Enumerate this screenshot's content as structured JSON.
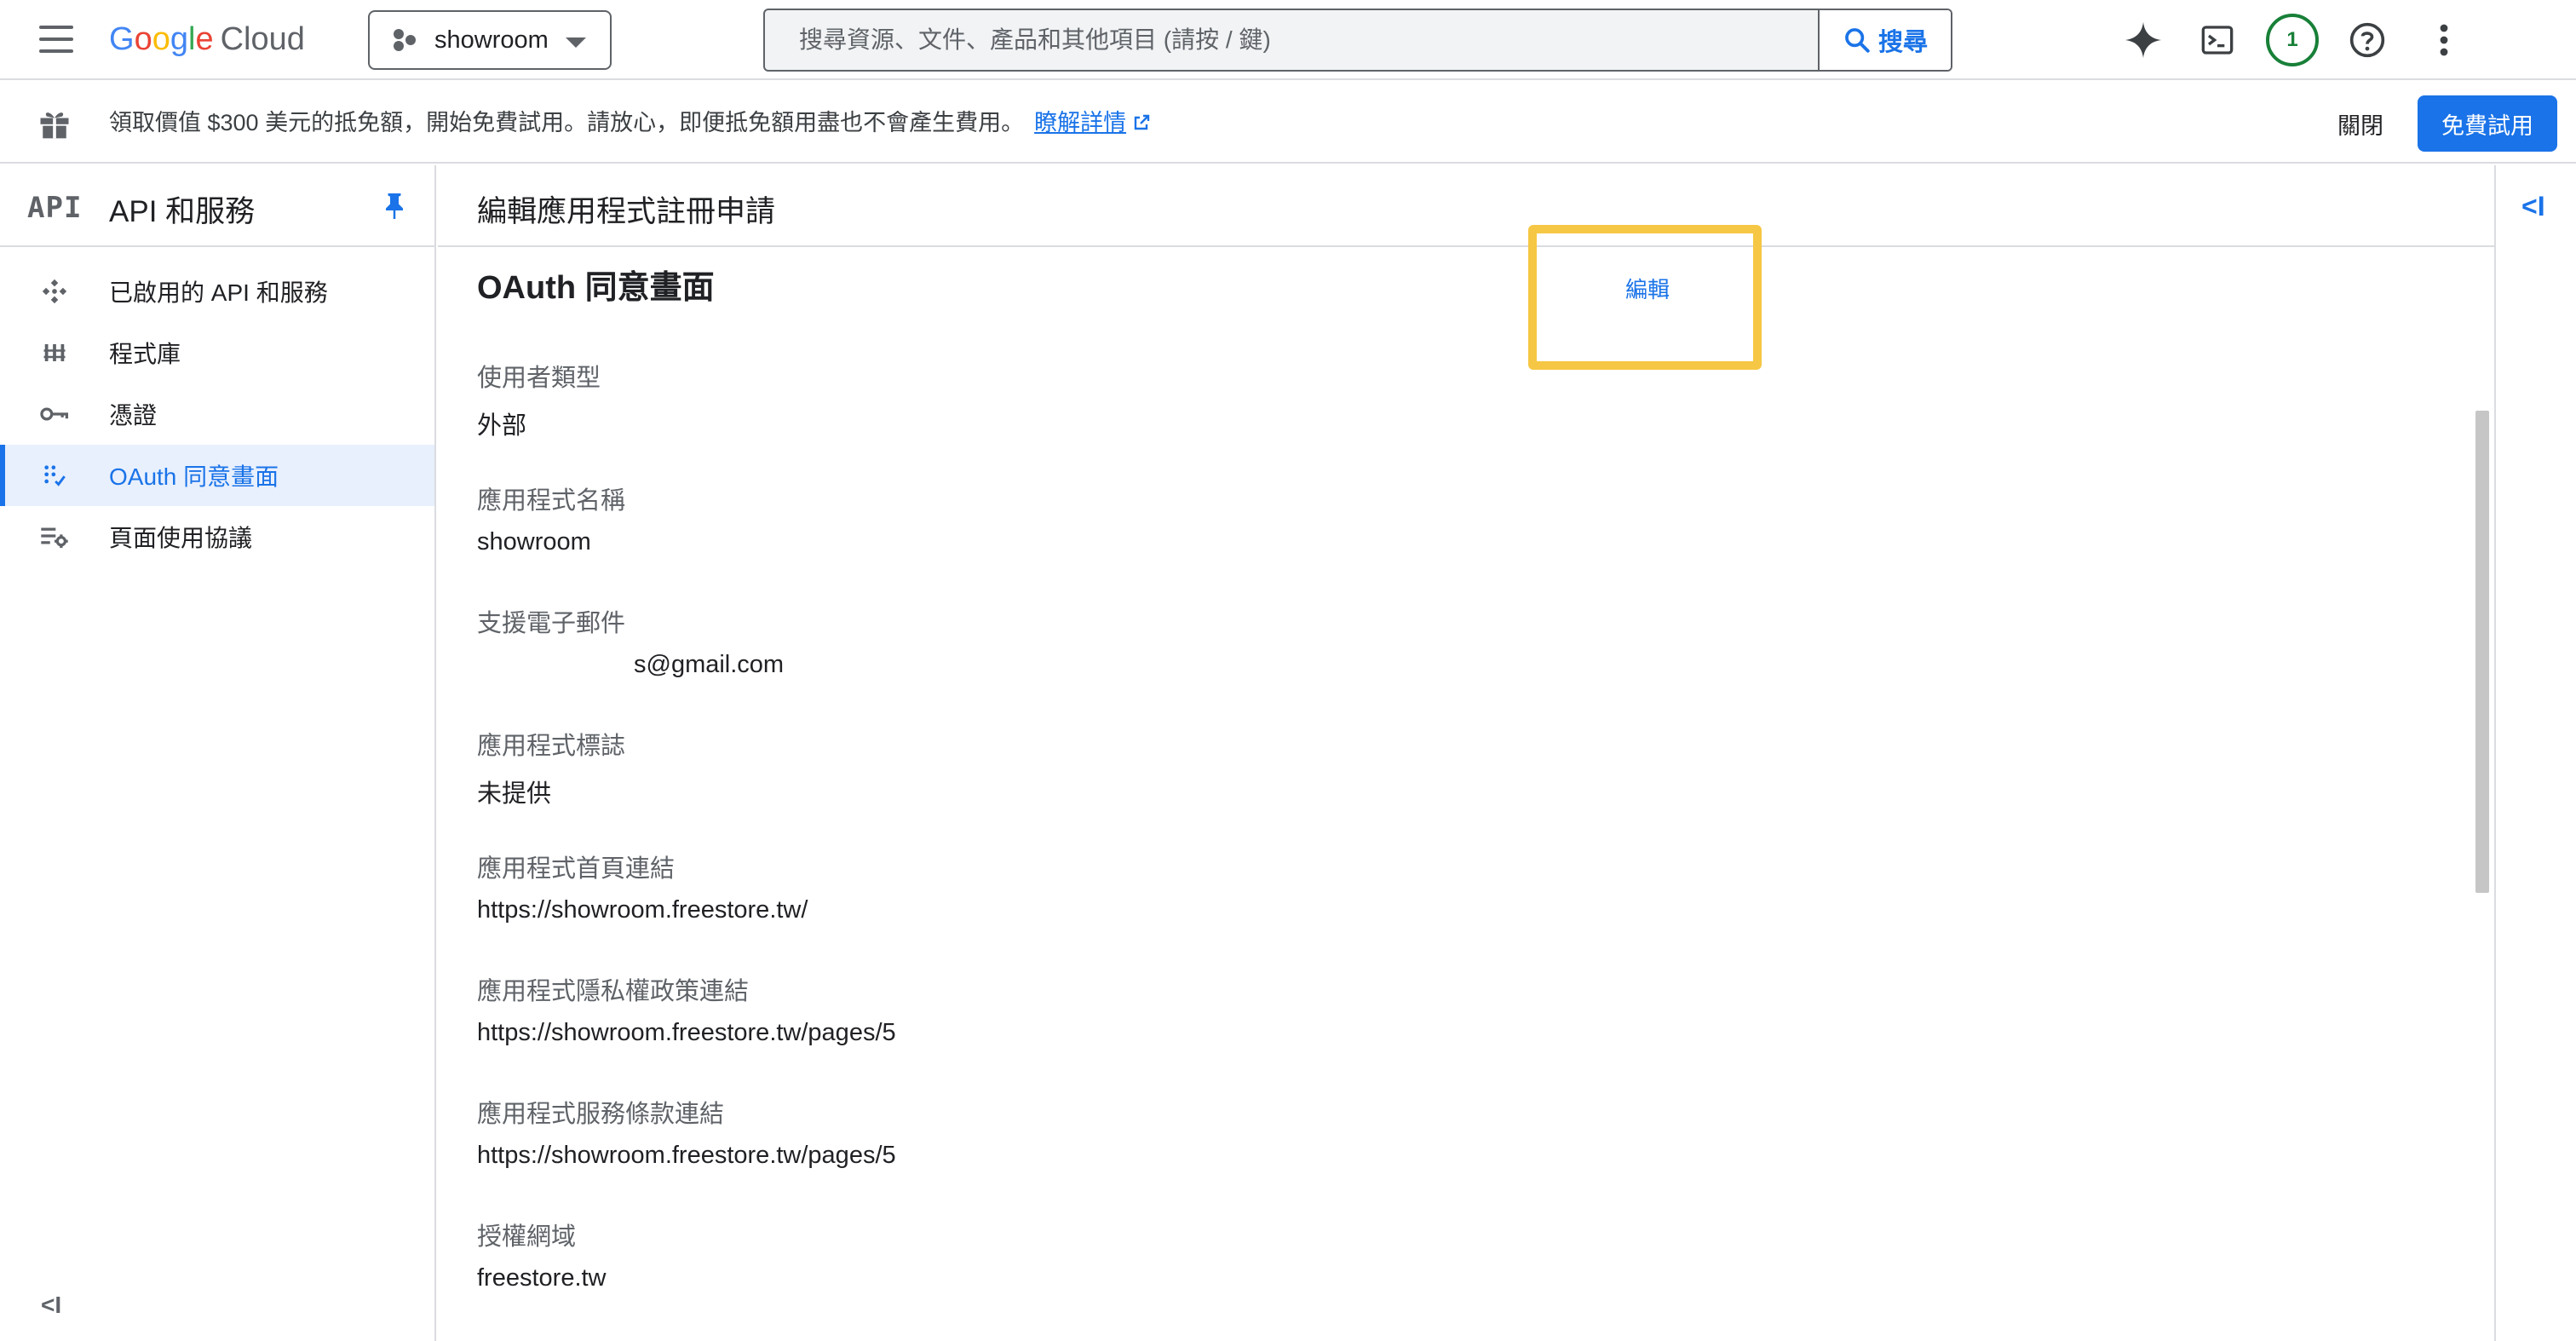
{
  "topbar": {
    "logo_parts": [
      "G",
      "o",
      "o",
      "g",
      "l",
      "e"
    ],
    "logo_suffix": "Cloud",
    "project_name": "showroom",
    "search_placeholder": "搜尋資源、文件、產品和其他項目 (請按 / 鍵)",
    "search_button": "搜尋",
    "notification_count": "1",
    "icons": [
      "menu-icon",
      "gemini-sparkle-icon",
      "cloud-shell-icon",
      "help-icon",
      "more-vert-icon"
    ]
  },
  "banner": {
    "message": "領取價值 $300 美元的抵免額，開始免費試用。請放心，即便抵免額用盡也不會產生費用。",
    "link": "瞭解詳情",
    "dismiss": "關閉",
    "trial_button": "免費試用"
  },
  "sidebar": {
    "logo": "API",
    "title": "API 和服務",
    "items": [
      {
        "label": "已啟用的 API 和服務",
        "icon": "api-services-icon"
      },
      {
        "label": "程式庫",
        "icon": "library-icon"
      },
      {
        "label": "憑證",
        "icon": "key-icon"
      },
      {
        "label": "OAuth 同意畫面",
        "icon": "oauth-consent-icon",
        "active": true
      },
      {
        "label": "頁面使用協議",
        "icon": "page-agreement-icon"
      }
    ],
    "collapse": "<I"
  },
  "main": {
    "page_title": "編輯應用程式註冊申請",
    "section_title": "OAuth 同意畫面",
    "edit_link": "編輯",
    "fields": [
      {
        "label": "使用者類型",
        "value": "外部"
      },
      {
        "label": "應用程式名稱",
        "value": "showroom"
      },
      {
        "label": "支援電子郵件",
        "value": "s@gmail.com"
      },
      {
        "label": "應用程式標誌",
        "value": "未提供"
      },
      {
        "label": "應用程式首頁連結",
        "value": "https://showroom.freestore.tw/"
      },
      {
        "label": "應用程式隱私權政策連結",
        "value": "https://showroom.freestore.tw/pages/5"
      },
      {
        "label": "應用程式服務條款連結",
        "value": "https://showroom.freestore.tw/pages/5"
      },
      {
        "label": "授權網域",
        "value": "freestore.tw"
      }
    ],
    "right_collapse": "<I"
  },
  "colors": {
    "accent": "#1a73e8",
    "highlight": "#f6c744",
    "active_bg": "#e8f0fe",
    "notification": "#188038"
  }
}
